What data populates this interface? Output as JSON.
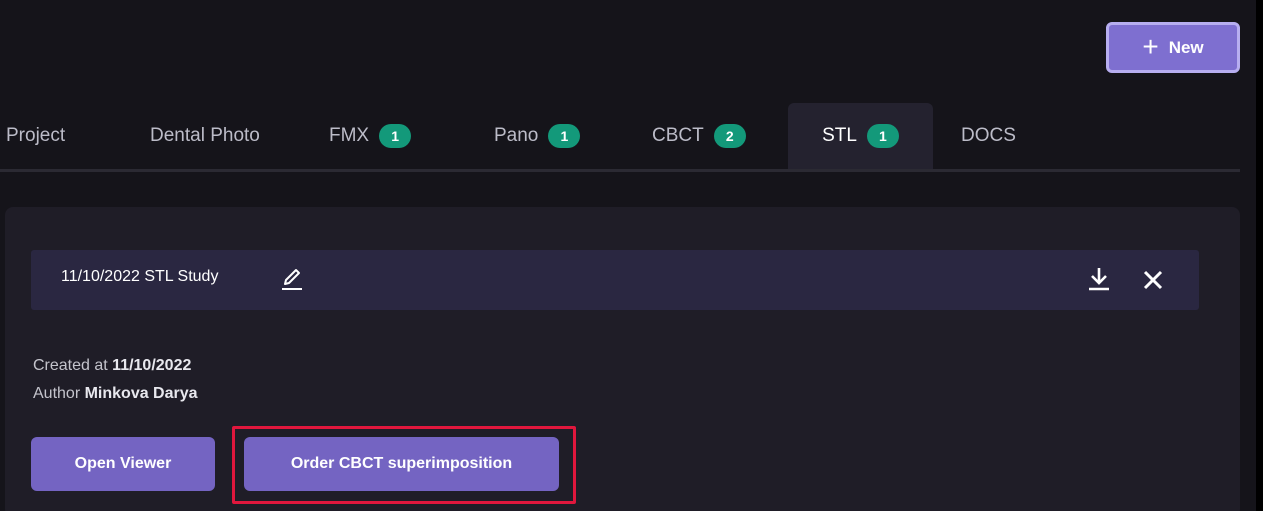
{
  "header": {
    "new_button_label": "New",
    "new_button_icon": "plus-icon"
  },
  "tabs": [
    {
      "label": "Project"
    },
    {
      "label": "Dental Photo"
    },
    {
      "label": "FMX",
      "badge": "1"
    },
    {
      "label": "Pano",
      "badge": "1"
    },
    {
      "label": "CBCT",
      "badge": "2"
    },
    {
      "label": "STL",
      "badge": "1",
      "active": true
    },
    {
      "label": "DOCS"
    }
  ],
  "study": {
    "title": "11/10/2022 STL Study",
    "edit_icon": "pencil-icon",
    "download_icon": "download-icon",
    "close_icon": "close-icon",
    "created_label": "Created at",
    "created_value": "11/10/2022",
    "author_label": "Author",
    "author_value": "Minkova Darya"
  },
  "actions": {
    "open_viewer_label": "Open Viewer",
    "order_superimposition_label": "Order CBCT superimposition"
  },
  "colors": {
    "accent": "#7464c2",
    "badge": "#13997a",
    "highlight": "#e0173d",
    "background": "#15141a"
  }
}
